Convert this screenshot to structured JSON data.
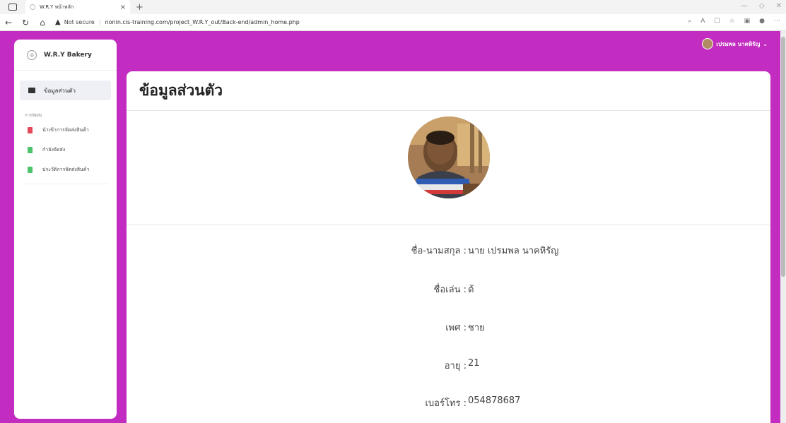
{
  "browser": {
    "tab_title": "W.R.Y หน้าหลัก",
    "tab_close": "×",
    "new_tab": "+",
    "security_label": "Not secure",
    "url": "nonin.cis-training.com/project_W.R.Y_out/Back-end/admin_home.php"
  },
  "sidebar": {
    "brand": "W.R.Y Bakery",
    "active_item": "ข้อมูลส่วนตัว",
    "section_label": "การจัดส่ง",
    "items": [
      {
        "label": "นำเข้าการจัดส่งสินค้า",
        "color": "#e24b5c"
      },
      {
        "label": "กำลังจัดส่ง",
        "color": "#4cc46b"
      },
      {
        "label": "ประวัติการจัดส่งสินค้า",
        "color": "#4cc46b"
      }
    ]
  },
  "user": {
    "name": "เปรมพล นาคหิรัญ"
  },
  "profile": {
    "title": "ข้อมูลส่วนตัว",
    "fields": [
      {
        "label": "ชื่อ-นามสกุล :",
        "value": "นาย เปรมพล นาคหิรัญ"
      },
      {
        "label": "ชื่อเล่น :",
        "value": "ต้"
      },
      {
        "label": "เพศ :",
        "value": "ชาย"
      },
      {
        "label": "อายุ :",
        "value": "21"
      },
      {
        "label": "เบอร์โทร :",
        "value": "054878687"
      }
    ]
  },
  "colors": {
    "page_background": "#c22cc0"
  }
}
